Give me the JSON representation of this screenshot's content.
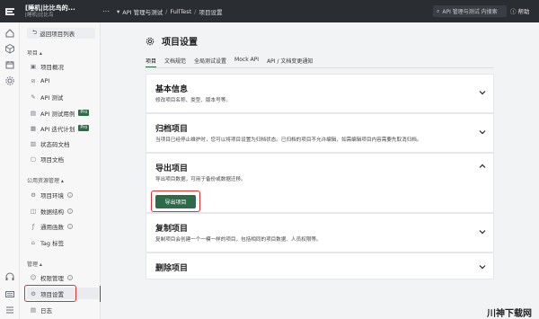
{
  "topbar": {
    "project_name": "[睡机|比比鸟的...",
    "project_sub": "[睡机|比比鸟",
    "breadcrumbs": [
      "API 管理与测试",
      "/",
      "FullTest",
      "/",
      "项目设置"
    ],
    "search_placeholder": "API 管理与测试 内搜索",
    "help_label": "帮助"
  },
  "sidebar": {
    "back_label": "返回项目列表",
    "section_project": "项目 ▴",
    "project_items": [
      {
        "label": "项目概况",
        "icon": "overview-icon"
      },
      {
        "label": "API",
        "icon": "api-icon"
      },
      {
        "label": "API 测试",
        "icon": "api-test-icon"
      },
      {
        "label": "API 测试用例",
        "icon": "test-case-icon",
        "badge": "Pro"
      },
      {
        "label": "API 迭代计划",
        "icon": "iteration-icon",
        "badge": "Pro"
      },
      {
        "label": "状态码文档",
        "icon": "status-code-icon"
      },
      {
        "label": "项目文档",
        "icon": "doc-icon"
      }
    ],
    "section_common": "公用资源管理 ▴",
    "common_items": [
      {
        "label": "项目环境",
        "icon": "environment-icon"
      },
      {
        "label": "数据结构",
        "icon": "data-structure-icon"
      },
      {
        "label": "通用函数",
        "icon": "function-icon"
      },
      {
        "label": "Tag 标签",
        "icon": "tag-icon"
      }
    ],
    "section_manage": "管理 ▴",
    "manage_items": [
      {
        "label": "权限管理",
        "icon": "permission-icon"
      },
      {
        "label": "项目设置",
        "icon": "settings-icon",
        "active": true
      },
      {
        "label": "日志",
        "icon": "log-icon"
      }
    ]
  },
  "main": {
    "title": "项目设置",
    "tabs": [
      "项目",
      "文档规范",
      "全局测试设置",
      "Mock API",
      "API / 文档变更通知"
    ],
    "cards": [
      {
        "title": "基本信息",
        "desc": "修改项目名称、类型、版本号等。"
      },
      {
        "title": "归档项目",
        "desc": "当项目已经停止维护时，您可以将项目设置为归档状态。已归档的项目不允许编辑，如需编辑项目内容需要先取消归档。"
      },
      {
        "title": "导出项目",
        "desc": "导出项目数据，可用于备份或数据迁移。",
        "button": "导出项目"
      },
      {
        "title": "复制项目",
        "desc": "复制项目会创建一个一模一样的项目，包括相同的项目数据、人员权限等。"
      },
      {
        "title": "删除项目",
        "desc": ""
      }
    ]
  },
  "watermark": "川神下载网",
  "colors": {
    "accent": "#2b6b48",
    "highlight": "#d9352f",
    "topbar": "#2a2d31"
  }
}
